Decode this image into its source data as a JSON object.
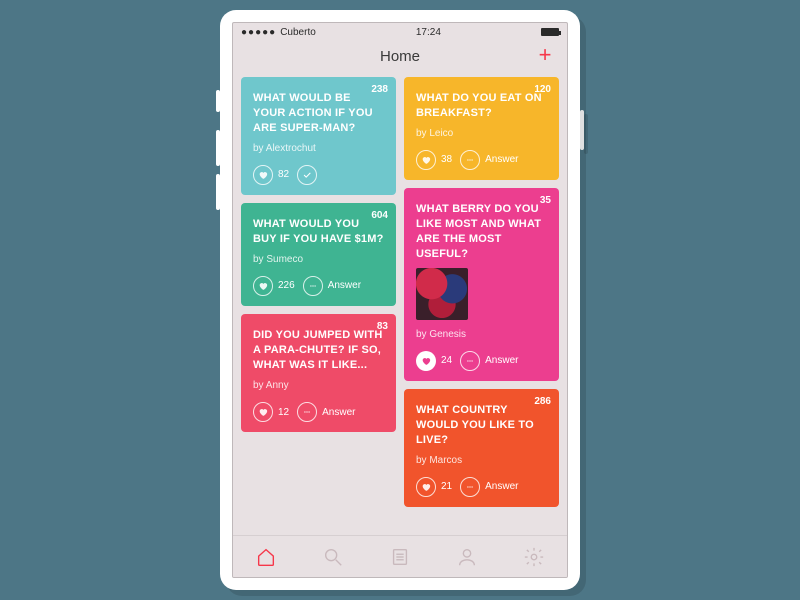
{
  "status": {
    "carrier": "Cuberto",
    "time": "17:24"
  },
  "header": {
    "title": "Home"
  },
  "cards": {
    "left": [
      {
        "question": "WHAT WOULD BE YOUR ACTION IF YOU ARE SUPER-MAN?",
        "author": "by Alextrochut",
        "count": "238",
        "likes": "82",
        "answered": true,
        "color": "c-teal"
      },
      {
        "question": "WHAT WOULD YOU BUY IF YOU HAVE $1M?",
        "author": "by Sumeco",
        "count": "604",
        "likes": "226",
        "answer_label": "Answer",
        "color": "c-green"
      },
      {
        "question": "DID YOU JUMPED WITH A PARA-CHUTE? IF SO, WHAT WAS IT LIKE...",
        "author": "by Anny",
        "count": "83",
        "likes": "12",
        "answer_label": "Answer",
        "color": "c-pinkred"
      }
    ],
    "right": [
      {
        "question": "WHAT DO YOU EAT ON BREAKFAST?",
        "author": "by Leico",
        "count": "120",
        "likes": "38",
        "answer_label": "Answer",
        "color": "c-yellow"
      },
      {
        "question": "WHAT BERRY DO YOU LIKE MOST AND WHAT ARE THE MOST USEFUL?",
        "author": "by Genesis",
        "count": "35",
        "likes": "24",
        "answer_label": "Answer",
        "has_thumb": true,
        "liked": true,
        "color": "c-magenta"
      },
      {
        "question": "WHAT COUNTRY WOULD YOU LIKE TO LIVE?",
        "author": "by Marcos",
        "count": "286",
        "likes": "21",
        "answer_label": "Answer",
        "color": "c-orange"
      }
    ]
  },
  "tabbar": {
    "items": [
      "home",
      "search",
      "list",
      "profile",
      "settings"
    ],
    "active": "home"
  }
}
